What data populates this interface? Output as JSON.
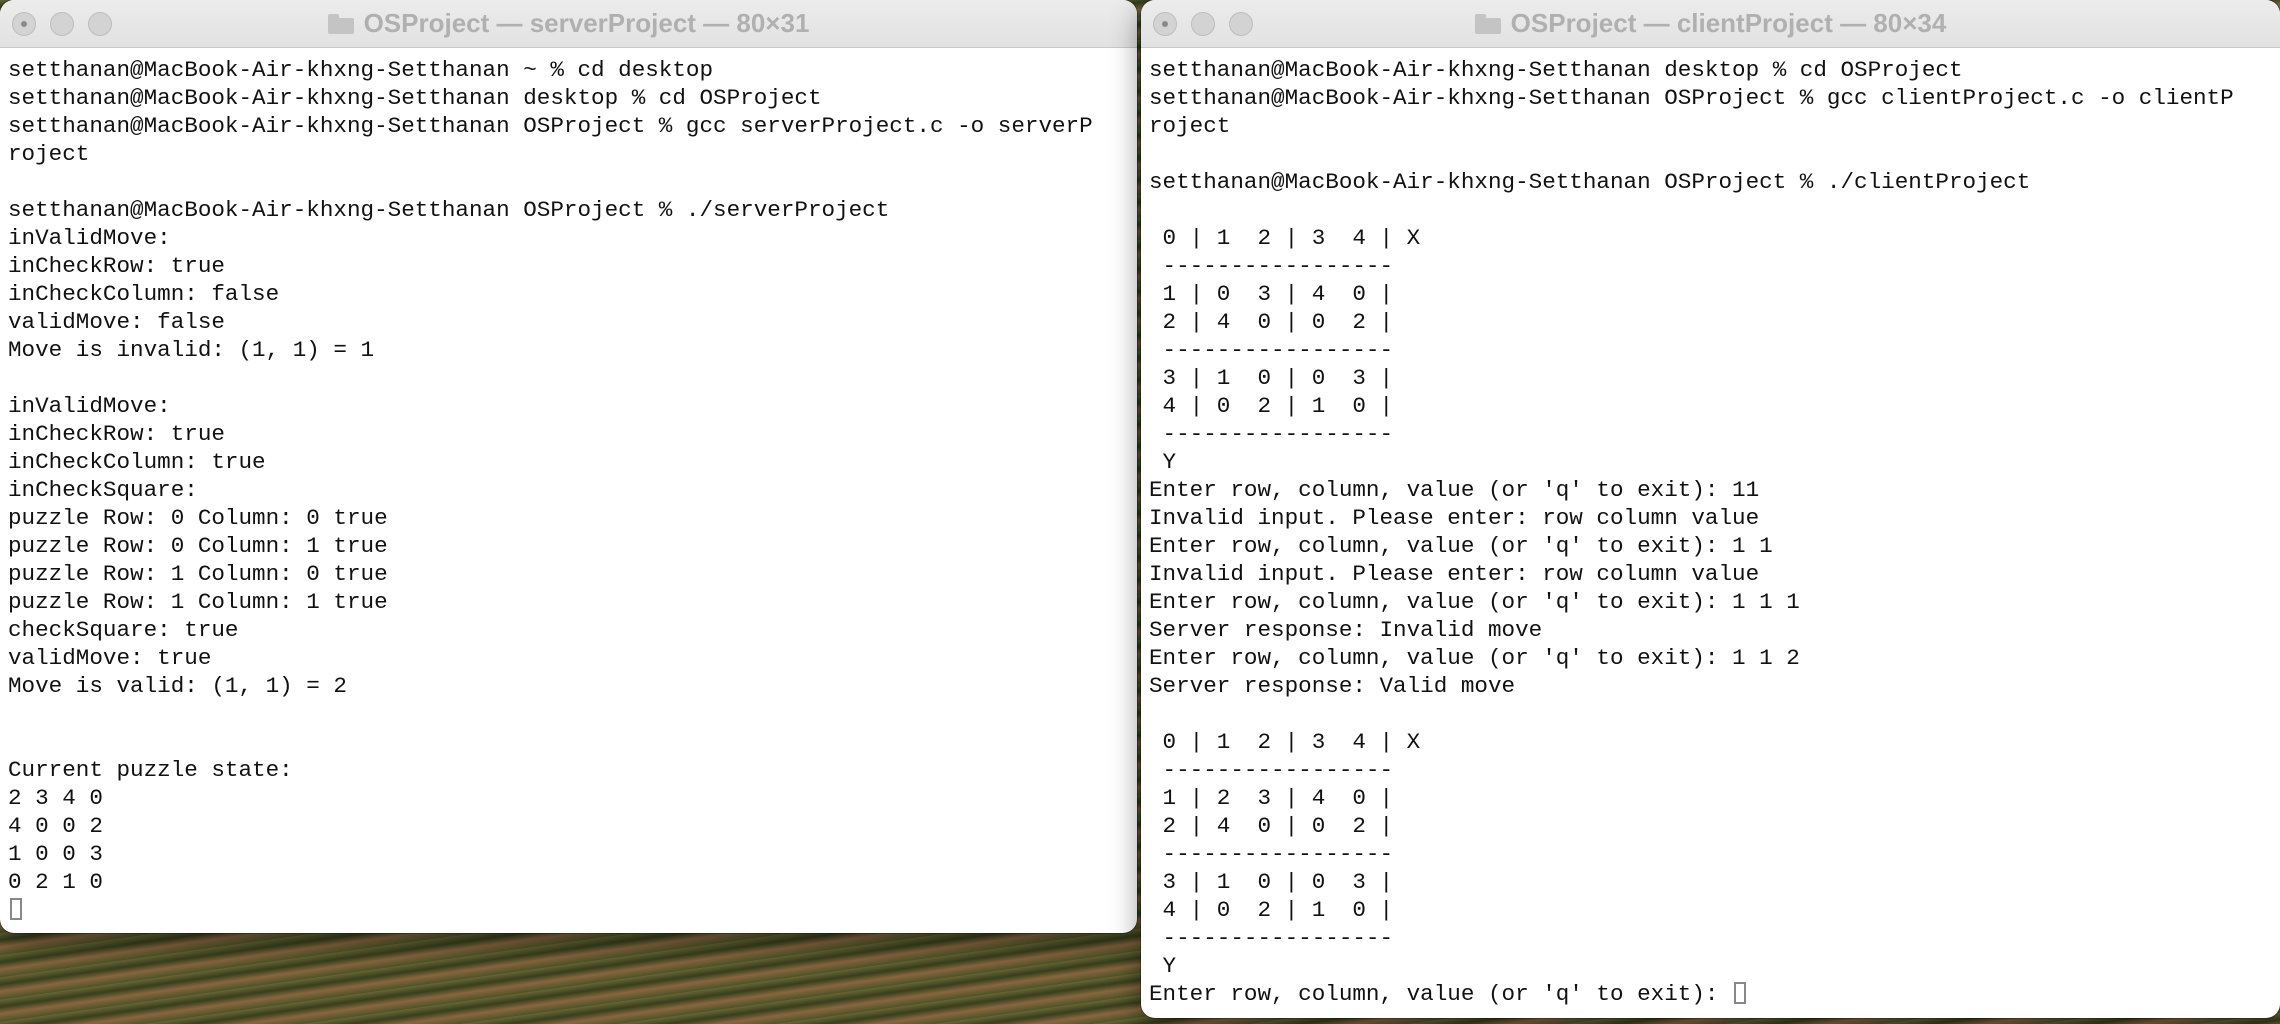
{
  "server_window": {
    "title": "OSProject — serverProject — 80×31",
    "lines": [
      "setthanan@MacBook-Air-khxng-Setthanan ~ % cd desktop",
      "setthanan@MacBook-Air-khxng-Setthanan desktop % cd OSProject",
      "setthanan@MacBook-Air-khxng-Setthanan OSProject % gcc serverProject.c -o serverP",
      "roject",
      "",
      "setthanan@MacBook-Air-khxng-Setthanan OSProject % ./serverProject",
      "inValidMove:",
      "inCheckRow: true",
      "inCheckColumn: false",
      "validMove: false",
      "Move is invalid: (1, 1) = 1",
      "",
      "inValidMove:",
      "inCheckRow: true",
      "inCheckColumn: true",
      "inCheckSquare:",
      "puzzle Row: 0 Column: 0 true",
      "puzzle Row: 0 Column: 1 true",
      "puzzle Row: 1 Column: 0 true",
      "puzzle Row: 1 Column: 1 true",
      "checkSquare: true",
      "validMove: true",
      "Move is valid: (1, 1) = 2",
      "",
      "",
      "Current puzzle state:",
      "2 3 4 0",
      "4 0 0 2",
      "1 0 0 3",
      "0 2 1 0"
    ]
  },
  "client_window": {
    "title": "OSProject — clientProject — 80×34",
    "lines": [
      "setthanan@MacBook-Air-khxng-Setthanan desktop % cd OSProject",
      "setthanan@MacBook-Air-khxng-Setthanan OSProject % gcc clientProject.c -o clientP",
      "roject",
      "",
      "setthanan@MacBook-Air-khxng-Setthanan OSProject % ./clientProject",
      "",
      " 0 | 1  2 | 3  4 | X",
      " -----------------",
      " 1 | 0  3 | 4  0 |",
      " 2 | 4  0 | 0  2 |",
      " -----------------",
      " 3 | 1  0 | 0  3 |",
      " 4 | 0  2 | 1  0 |",
      " -----------------",
      " Y",
      "Enter row, column, value (or 'q' to exit): 11",
      "Invalid input. Please enter: row column value",
      "Enter row, column, value (or 'q' to exit): 1 1",
      "Invalid input. Please enter: row column value",
      "Enter row, column, value (or 'q' to exit): 1 1 1",
      "Server response: Invalid move",
      "Enter row, column, value (or 'q' to exit): 1 1 2",
      "Server response: Valid move",
      "",
      " 0 | 1  2 | 3  4 | X",
      " -----------------",
      " 1 | 2  3 | 4  0 |",
      " 2 | 4  0 | 0  2 |",
      " -----------------",
      " 3 | 1  0 | 0  3 |",
      " 4 | 0  2 | 1  0 |",
      " -----------------",
      " Y"
    ],
    "prompt": "Enter row, column, value (or 'q' to exit): "
  }
}
